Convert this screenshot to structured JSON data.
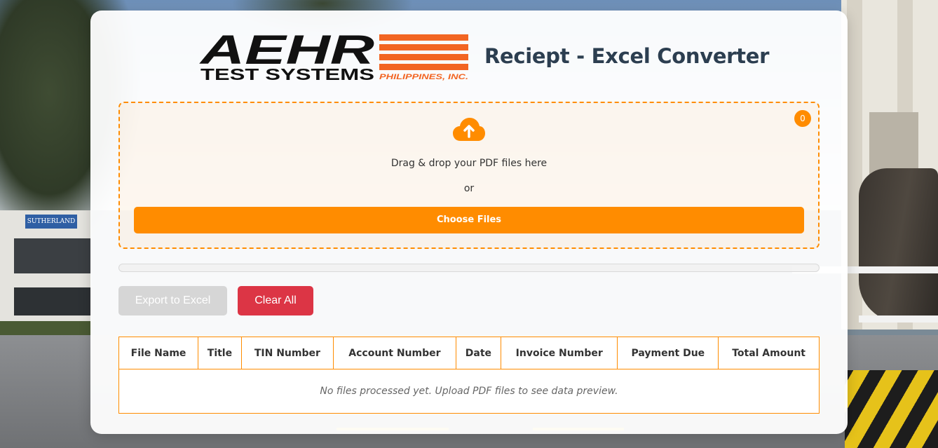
{
  "header": {
    "logo_main": "AEHR",
    "logo_sub": "TEST SYSTEMS",
    "logo_company": "PHILIPPINES, INC.",
    "title": "Reciept - Excel Converter"
  },
  "background": {
    "sign_text": "SUTHERLAND"
  },
  "dropzone": {
    "file_count": "0",
    "instruction": "Drag & drop your PDF files here",
    "or_text": "or",
    "choose_label": "Choose Files",
    "icon": "cloud-upload-icon"
  },
  "progress": {
    "value": 0
  },
  "actions": {
    "export_label": "Export to Excel",
    "clear_label": "Clear All"
  },
  "table": {
    "columns": [
      "File Name",
      "Title",
      "TIN Number",
      "Account Number",
      "Date",
      "Invoice Number",
      "Payment Due",
      "Total Amount"
    ],
    "empty_message": "No files processed yet. Upload PDF files to see data preview."
  },
  "colors": {
    "accent": "#ff8c00",
    "danger": "#dc3545",
    "disabled": "#d6d6d6",
    "title": "#2c3e50",
    "logo_black": "#111111",
    "logo_orange": "#f26522"
  }
}
